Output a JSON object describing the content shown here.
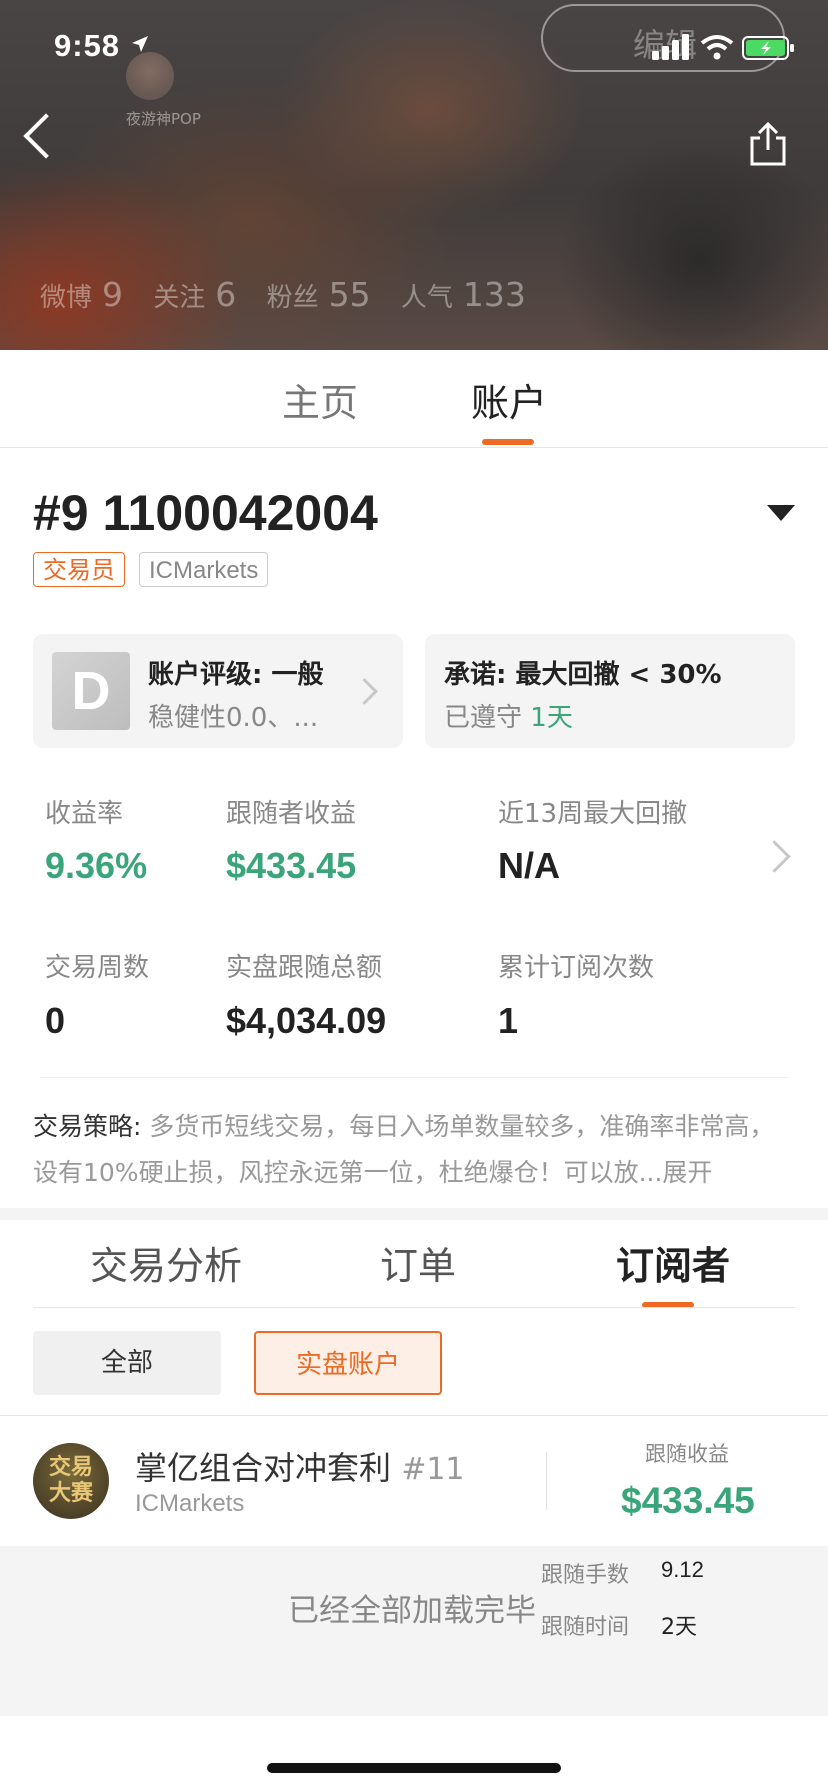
{
  "status_bar": {
    "time": "9:58"
  },
  "header": {
    "edit_label": "编辑",
    "nickname": "夜游神POP",
    "stats": [
      {
        "label": "微博",
        "value": "9"
      },
      {
        "label": "关注",
        "value": "6"
      },
      {
        "label": "粉丝",
        "value": "55"
      },
      {
        "label": "人气",
        "value": "133"
      }
    ]
  },
  "main_tabs": [
    {
      "label": "主页"
    },
    {
      "label": "账户"
    }
  ],
  "account": {
    "title": "#9 1100042004",
    "tags": [
      "交易员",
      "ICMarkets"
    ],
    "rating": {
      "badge": "D",
      "title": "账户评级: 一般",
      "subtitle": "稳健性0.0、..."
    },
    "promise": {
      "title": "承诺: 最大回撤 < 30%",
      "prefix": "已遵守",
      "days": "1天"
    },
    "stats": [
      {
        "label": "收益率",
        "value": "9.36%"
      },
      {
        "label": "跟随者收益",
        "value": "$433.45"
      },
      {
        "label": "近13周最大回撤",
        "value": "N/A"
      },
      {
        "label": "交易周数",
        "value": "0"
      },
      {
        "label": "实盘跟随总额",
        "value": "$4,034.09"
      },
      {
        "label": "累计订阅次数",
        "value": "1"
      }
    ],
    "strategy": {
      "label": "交易策略:",
      "text": "多货币短线交易，每日入场单数量较多，准确率非常高，设有10%硬止损，风控永远第一位，杜绝爆仓！可以放...",
      "expand": "展开"
    }
  },
  "sub_tabs": [
    {
      "label": "交易分析"
    },
    {
      "label": "订单"
    },
    {
      "label": "订阅者"
    }
  ],
  "filters": [
    {
      "label": "全部"
    },
    {
      "label": "实盘账户"
    }
  ],
  "subscribers": [
    {
      "avatar_text": "交易大赛",
      "name": "掌亿组合对冲套利",
      "rank": "#11",
      "broker": "ICMarkets",
      "profit_label": "跟随收益",
      "profit": "$433.45",
      "lots_label": "跟随手数",
      "lots": "9.12",
      "time_label": "跟随时间",
      "time": "2天"
    }
  ],
  "footer": {
    "loaded_text": "已经全部加载完毕"
  },
  "colors": {
    "accent": "#ee6a24",
    "positive": "#3aa57a"
  }
}
